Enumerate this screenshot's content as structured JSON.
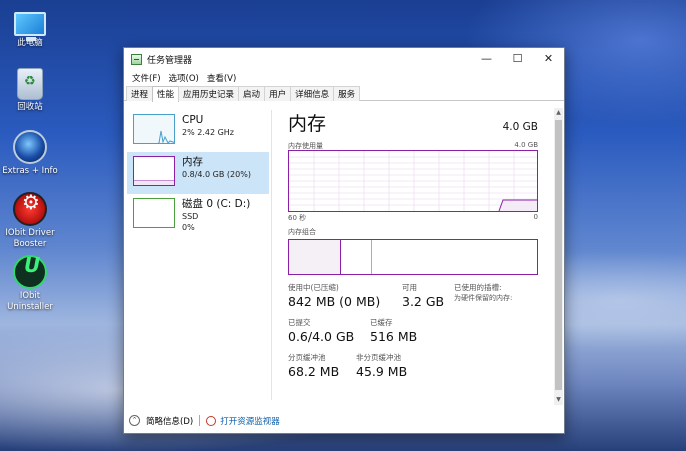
{
  "desktop": {
    "icons": [
      {
        "label": "此电脑",
        "icon": "computer-icon"
      },
      {
        "label": "回收站",
        "icon": "recycle-bin-icon"
      },
      {
        "label": "Extras + Info",
        "icon": "extras-info-icon"
      },
      {
        "label": "IObit Driver Booster",
        "icon": "driver-booster-icon"
      },
      {
        "label": "IObit Uninstaller",
        "icon": "iobit-uninstaller-icon"
      }
    ]
  },
  "window": {
    "title": "任务管理器",
    "controls": {
      "minimize": "—",
      "maximize": "☐",
      "close": "✕"
    },
    "menu": [
      "文件(F)",
      "选项(O)",
      "查看(V)"
    ],
    "tabs": [
      "进程",
      "性能",
      "应用历史记录",
      "启动",
      "用户",
      "详细信息",
      "服务"
    ],
    "active_tab": "性能"
  },
  "sidebar": {
    "items": [
      {
        "title": "CPU",
        "sub1": "2% 2.42 GHz",
        "sub2": ""
      },
      {
        "title": "内存",
        "sub1": "0.8/4.0 GB (20%)",
        "sub2": ""
      },
      {
        "title": "磁盘 0 (C: D:)",
        "sub1": "SSD",
        "sub2": "0%"
      }
    ],
    "selected": 1
  },
  "main": {
    "title": "内存",
    "total": "4.0 GB",
    "usage_label": "内存使用量",
    "usage_max": "4.0 GB",
    "time_left": "60 秒",
    "time_right": "0",
    "composition_label": "内存组合",
    "stats": {
      "in_use": {
        "label": "使用中(已压缩)",
        "value": "842 MB (0 MB)"
      },
      "available": {
        "label": "可用",
        "value": "3.2 GB"
      },
      "reserved": {
        "label": "已使用的插槽:",
        "label2": "为硬件保留的内存:"
      },
      "committed": {
        "label": "已提交",
        "value": "0.6/4.0 GB"
      },
      "cached": {
        "label": "已缓存",
        "value": "516 MB"
      },
      "paged_pool": {
        "label": "分页缓冲池",
        "value": "68.2 MB"
      },
      "nonpaged_pool": {
        "label": "非分页缓冲池",
        "value": "45.9 MB"
      }
    }
  },
  "footer": {
    "fewer_details": "简略信息(D)",
    "open_monitor": "打开资源监视器"
  },
  "colors": {
    "memory_accent": "#8b1fa8",
    "cpu_accent": "#4a9fc9",
    "disk_accent": "#4aa03c",
    "selection": "#cce4f7",
    "link": "#0b5ca8"
  }
}
